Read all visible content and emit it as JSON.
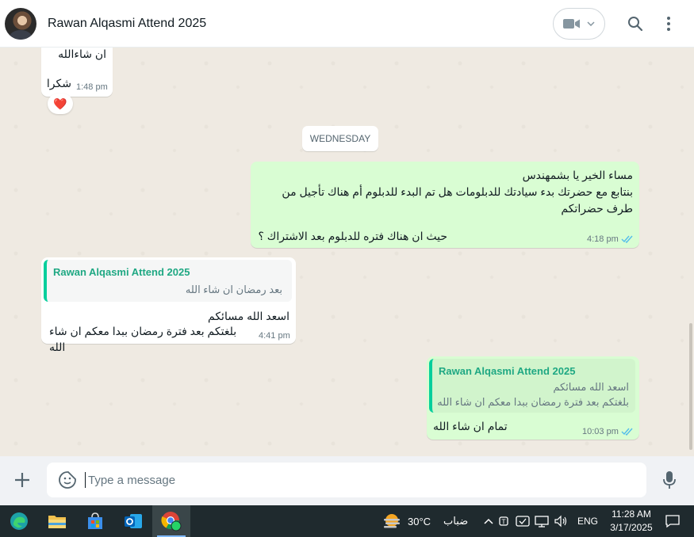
{
  "header": {
    "contact_name": "Rawan Alqasmi Attend 2025"
  },
  "chat": {
    "msg_prev": {
      "line1": "ان شاءالله",
      "line2": "شكرا",
      "time": "1:48 pm",
      "reaction": "❤️"
    },
    "day_label": "WEDNESDAY",
    "msg_out1": {
      "line1": "مساء الخير يا بشمهندس",
      "line2": "بنتابع مع حضرتك بدء سيادتك للدبلومات هل تم البدء للدبلوم أم هناك تأجيل من",
      "line3": "طرف حضراتكم",
      "line4": "حيث ان هناك فتره للدبلوم بعد الاشتراك ؟",
      "time": "4:18 pm"
    },
    "msg_in1": {
      "quote_name": "Rawan Alqasmi Attend 2025",
      "quote_text": "بعد رمضان ان شاء الله",
      "line1": "اسعد الله مسائكم",
      "line2": "بلغتكم بعد فترة رمضان ببدا معكم ان شاء الله",
      "time": "4:41 pm"
    },
    "msg_out2": {
      "quote_name": "Rawan Alqasmi Attend 2025",
      "quote_line1": "اسعد الله مسائكم",
      "quote_line2": "بلغتكم بعد فترة رمضان ببدا معكم ان شاء الله",
      "line1": "تمام ان شاء الله",
      "time": "10:03 pm"
    }
  },
  "composer": {
    "placeholder": "Type a message"
  },
  "taskbar": {
    "weather_temp": "30°C",
    "weather_desc": "ضباب",
    "lang": "ENG",
    "time": "11:28 AM",
    "date": "3/17/2025"
  },
  "colors": {
    "accent": "#06cf9c",
    "outgoing": "#d9fdd3",
    "tick": "#53bdeb"
  }
}
